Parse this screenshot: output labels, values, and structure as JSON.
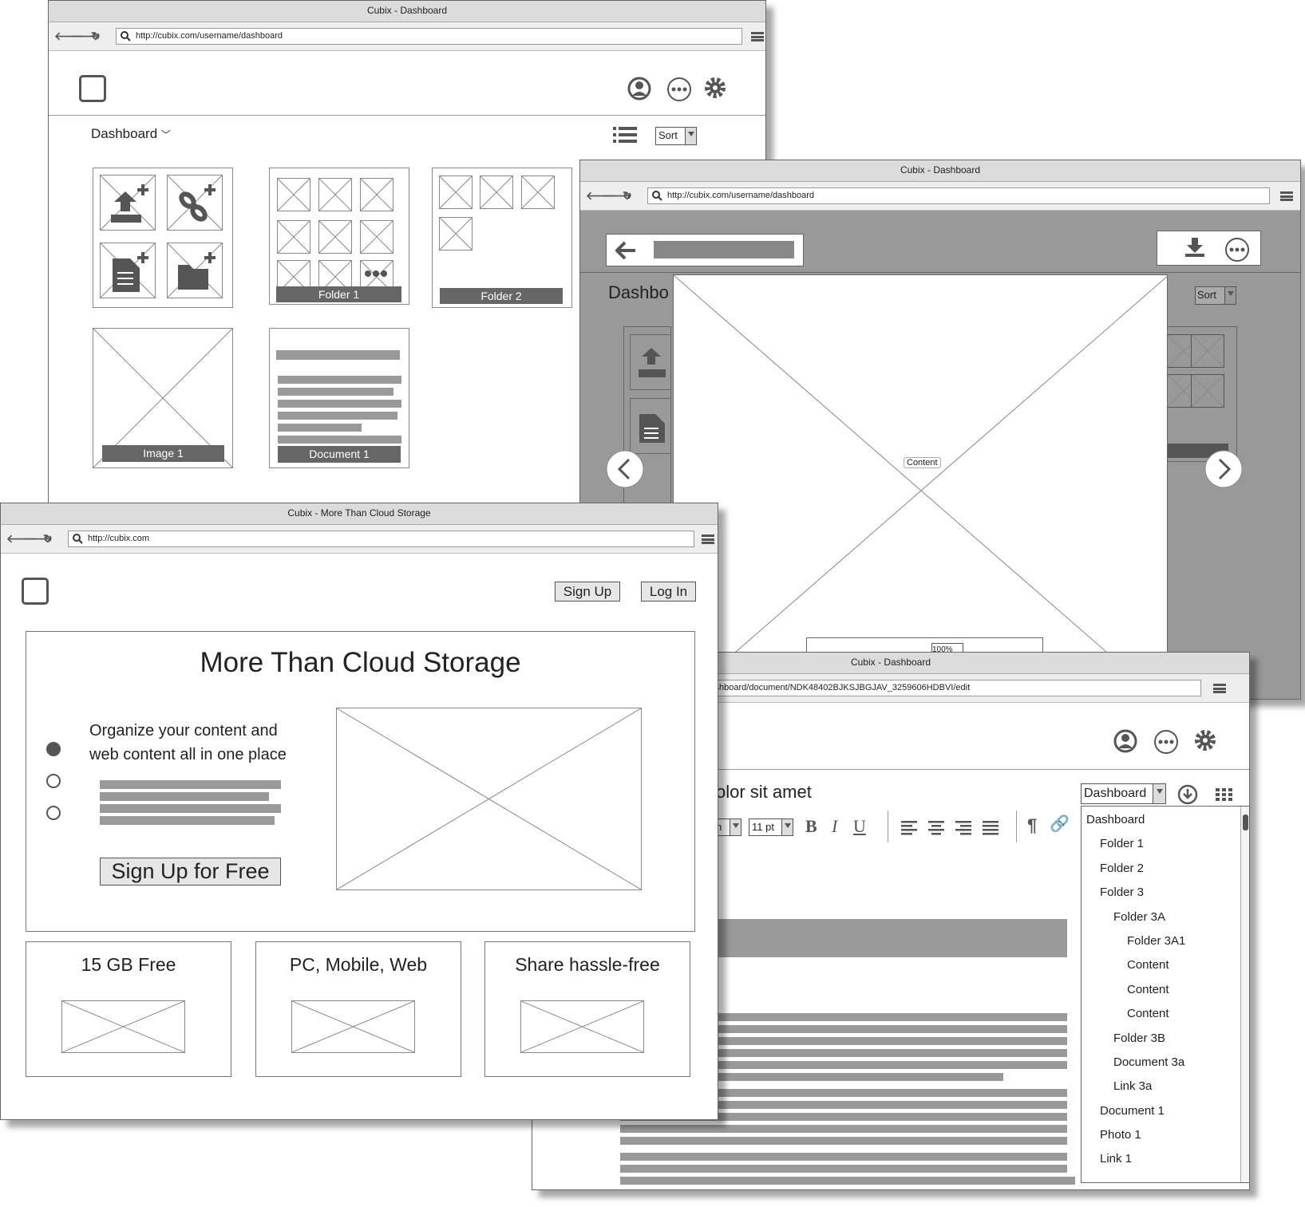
{
  "dashboard_window": {
    "title": "Cubix - Dashboard",
    "url": "http://cubix.com/username/dashboard",
    "breadcrumb": "Dashboard",
    "sort_label": "Sort",
    "tiles": {
      "folder1": "Folder 1",
      "folder2": "Folder 2",
      "image1": "Image 1",
      "document1": "Document 1"
    }
  },
  "viewer_window": {
    "title": "Cubix - Dashboard",
    "url": "http://cubix.com/username/dashboard",
    "breadcrumb_partial": "Dashbo",
    "sort_partial": "Sort",
    "content_label": "Content",
    "zoom": "100%"
  },
  "editor_window": {
    "title": "Cubix - Dashboard",
    "url": "ne/dashboard/document/NDK48402BJKSJBGJAV_3259606HDBVI/edit",
    "doc_title": "olor sit amet",
    "font_partial": "n",
    "font_size": "11 pt",
    "location_select": "Dashboard",
    "tree": [
      "Dashboard",
      "Folder 1",
      "Folder 2",
      "Folder 3",
      "Folder 3A",
      "Folder 3A1",
      "Content",
      "Content",
      "Content",
      "Folder 3B",
      "Document 3a",
      "Link 3a",
      "Document 1",
      "Photo 1",
      "Link 1"
    ]
  },
  "landing_window": {
    "title": "Cubix - More Than Cloud Storage",
    "url": "http://cubix.com",
    "signup": "Sign Up",
    "login": "Log In",
    "hero_title": "More Than Cloud Storage",
    "hero_text": "Organize your content and web content all in one place",
    "cta": "Sign Up for Free",
    "features": [
      "15 GB Free",
      "PC, Mobile, Web",
      "Share hassle-free"
    ]
  }
}
